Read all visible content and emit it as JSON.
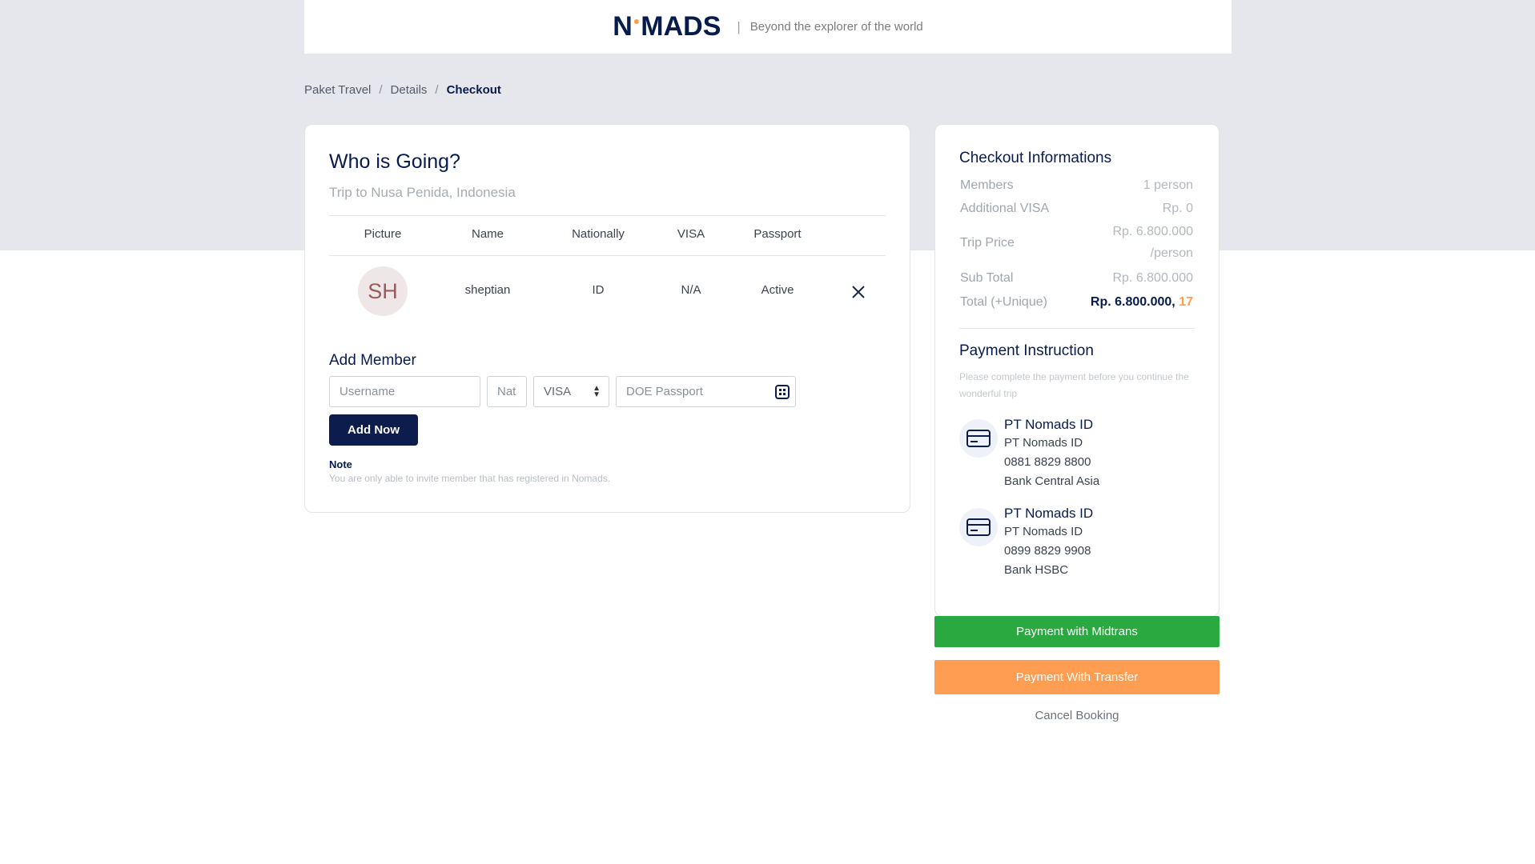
{
  "header": {
    "logo_left": "N",
    "logo_right": "MADS",
    "separator": "|",
    "tagline": "Beyond the explorer of the world"
  },
  "breadcrumb": {
    "items": [
      "Paket Travel",
      "Details",
      "Checkout"
    ],
    "separator": "/"
  },
  "main": {
    "title": "Who is Going?",
    "subtitle": "Trip to Nusa Penida, Indonesia",
    "columns": [
      "Picture",
      "Name",
      "Nationally",
      "VISA",
      "Passport"
    ],
    "members": [
      {
        "initials": "SH",
        "name": "sheptian",
        "nationality": "ID",
        "visa": "N/A",
        "passport": "Active"
      }
    ],
    "add_member": {
      "title": "Add Member",
      "username_placeholder": "Username",
      "nat_placeholder": "Nat",
      "visa_selected": "VISA",
      "passport_placeholder": "DOE Passport",
      "add_button": "Add Now"
    },
    "note_title": "Note",
    "note_text": "You are only able to invite member that has registered in Nomads."
  },
  "checkout": {
    "title": "Checkout Informations",
    "rows": {
      "members_label": "Members",
      "members_value": "1 person",
      "visa_label": "Additional VISA",
      "visa_value": "Rp. 0",
      "trip_label": "Trip Price",
      "trip_value": "Rp. 6.800.000",
      "trip_unit": "/person",
      "subtotal_label": "Sub Total",
      "subtotal_value": "Rp. 6.800.000",
      "total_label": "Total (+Unique)",
      "total_value": "Rp. 6.800.000,",
      "total_unique": "17"
    },
    "payment": {
      "title": "Payment Instruction",
      "subtitle": "Please complete the payment before you continue the wonderful trip",
      "banks": [
        {
          "name": "PT Nomads ID",
          "holder": "PT Nomads ID",
          "account": "0881 8829 8800",
          "bank": "Bank Central Asia"
        },
        {
          "name": "PT Nomads ID",
          "holder": "PT Nomads ID",
          "account": "0899 8829 9908",
          "bank": "Bank HSBC"
        }
      ]
    }
  },
  "actions": {
    "midtrans": "Payment with Midtrans",
    "transfer": "Payment With Transfer",
    "cancel": "Cancel Booking"
  },
  "colors": {
    "navy": "#071c4d",
    "accent_orange": "#ff9e53",
    "green": "#2ba941",
    "bg_gray": "#e5e7ec"
  }
}
